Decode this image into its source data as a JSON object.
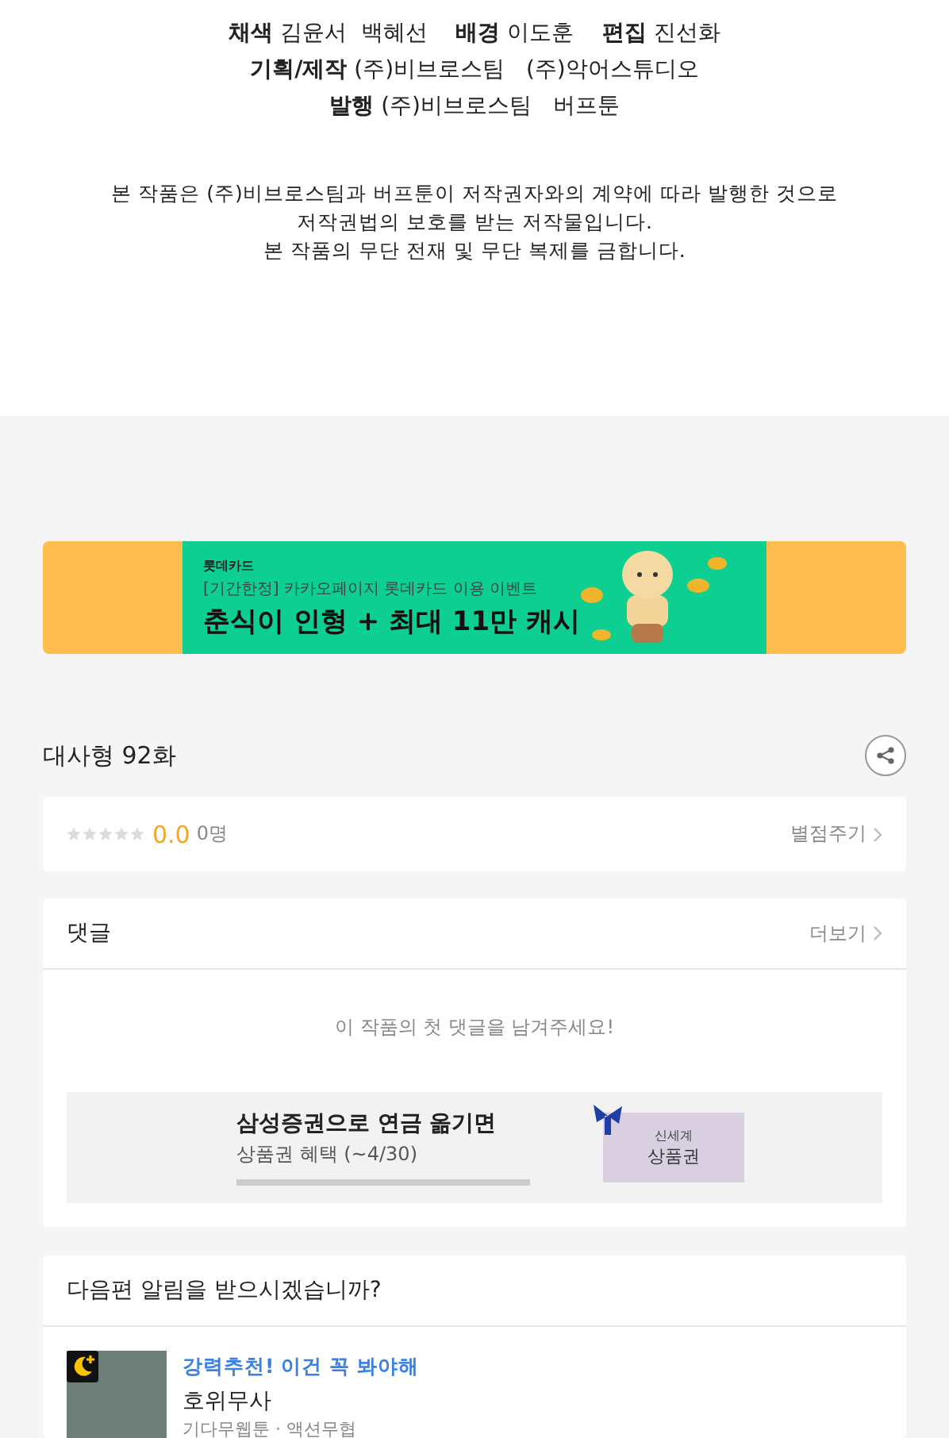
{
  "credits": [
    "**채색** 김윤서  백혜선    **배경** 이도훈    **편집** 진선화",
    "**기획/제작** (주)비브로스팀   (주)악어스튜디오",
    "**발행** (주)비브로스팀   버프툰"
  ],
  "copyright": [
    "본 작품은 (주)비브로스팀과 버프툰이 저작권자와의 계약에 따라 발행한 것으로",
    "저작권법의 보호를 받는 저작물입니다.",
    "본 작품의 무단 전재 및 무단 복제를 금합니다."
  ],
  "banner": {
    "brand": "롯데카드",
    "subtitle": "[기간한정] 카카오페이지 롯데카드 이용 이벤트",
    "headline": "춘식이 인형 + 최대 11만 캐시"
  },
  "episode_title": "대사형 92화",
  "rating": {
    "stars": 0,
    "score": "0.0",
    "count": "0명",
    "action": "별점주기"
  },
  "comments": {
    "title": "댓글",
    "more": "더보기",
    "empty": "이 작품의 첫 댓글을 남겨주세요!",
    "ad": {
      "headline": "삼성증권으로 연금 옮기면",
      "sub": "상품권 혜택 (~4/30)",
      "voucher_top": "신세계",
      "voucher_main": "상품권"
    }
  },
  "notify": {
    "question": "다음편 알림을 받으시겠습니까?",
    "recommendation": {
      "tag": "강력추천! 이건 꼭 봐야해",
      "title": "호위무사",
      "meta": "기다무웹툰 · 액션무협"
    }
  }
}
